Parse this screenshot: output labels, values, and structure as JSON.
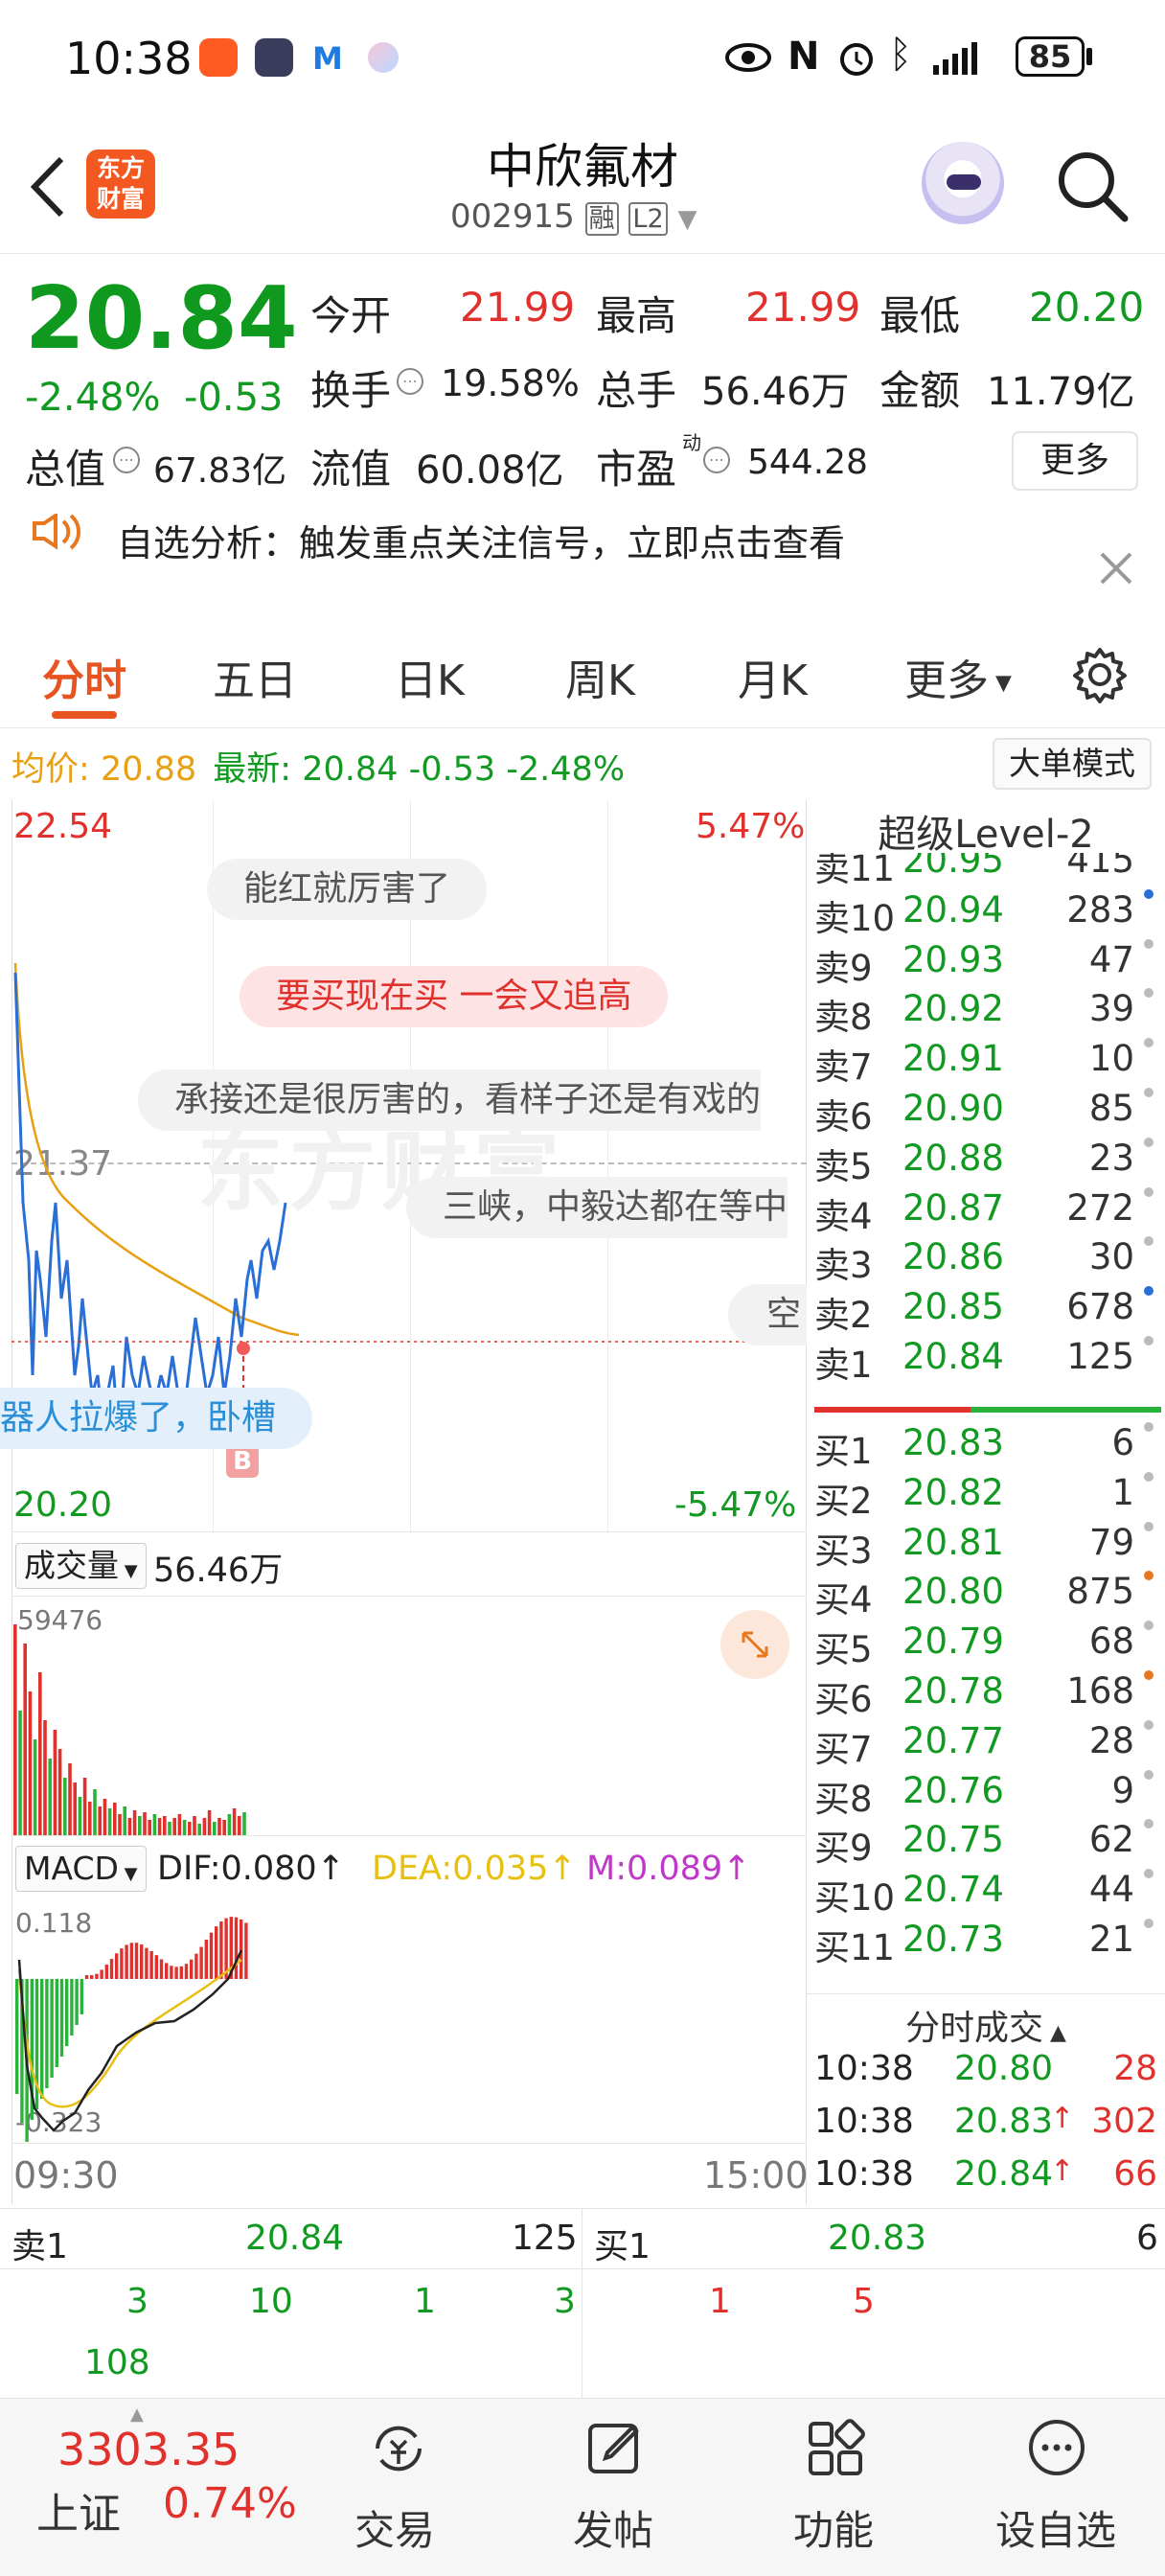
{
  "status_bar": {
    "time": "10:38",
    "battery": "85"
  },
  "header": {
    "logo_line1": "东方",
    "logo_line2": "财富",
    "stock_name": "中欣氟材",
    "code": "002915",
    "tag_margin": "融",
    "tag_level": "L2"
  },
  "quote": {
    "price": "20.84",
    "change_pct": "-2.48%",
    "change": "-0.53",
    "open_label": "今开",
    "open": "21.99",
    "high_label": "最高",
    "high": "21.99",
    "low_label": "最低",
    "low": "20.20",
    "turnover_label": "换手",
    "turnover": "19.58%",
    "volume_label": "总手",
    "volume": "56.46万",
    "amount_label": "金额",
    "amount": "11.79亿",
    "mktcap_label": "总值",
    "mktcap": "67.83亿",
    "float_label": "流值",
    "float": "60.08亿",
    "pe_label": "市盈",
    "pe_sup": "动",
    "pe": "544.28",
    "more": "更多"
  },
  "notice": {
    "text": "自选分析：触发重点关注信号，立即点击查看"
  },
  "tabs": [
    "分时",
    "五日",
    "日K",
    "周K",
    "月K",
    "更多"
  ],
  "info_line": {
    "avg_label": "均价:",
    "avg": "20.88",
    "latest_label": "最新:",
    "latest": "20.84",
    "chg": "-0.53",
    "pct": "-2.48%",
    "big_order_mode": "大单模式"
  },
  "chart": {
    "y_top": "22.54",
    "y_top_pct": "5.47%",
    "y_mid": "21.37",
    "y_bottom": "20.20",
    "y_bottom_pct": "-5.47%",
    "volume_label": "成交量",
    "volume_total": "56.46万",
    "volume_max": "59476",
    "macd_label": "MACD",
    "dif": "DIF:0.080↑",
    "dea": "DEA:0.035↑",
    "m": "M:0.089↑",
    "macd_max": "0.118",
    "macd_min": "-0.323",
    "time_start": "09:30",
    "time_end": "15:00",
    "buy_marker": "B"
  },
  "danmaku": [
    "能红就厉害了",
    "要买现在买  一会又追高",
    "承接还是很厉害的，看样子还是有戏的",
    "三峡，中毅达都在等中",
    "空",
    "器人拉爆了，卧槽"
  ],
  "level2": {
    "title": "超级Level-2",
    "asks": [
      {
        "label": "卖11",
        "price": "20.95",
        "vol": "415",
        "dot": "#2a6fd6"
      },
      {
        "label": "卖10",
        "price": "20.94",
        "vol": "283",
        "dot": "#2a6fd6"
      },
      {
        "label": "卖9",
        "price": "20.93",
        "vol": "47",
        "dot": "#bbbbbb"
      },
      {
        "label": "卖8",
        "price": "20.92",
        "vol": "39",
        "dot": "#bbbbbb"
      },
      {
        "label": "卖7",
        "price": "20.91",
        "vol": "10",
        "dot": "#bbbbbb"
      },
      {
        "label": "卖6",
        "price": "20.90",
        "vol": "85",
        "dot": "#bbbbbb"
      },
      {
        "label": "卖5",
        "price": "20.88",
        "vol": "23",
        "dot": "#bbbbbb"
      },
      {
        "label": "卖4",
        "price": "20.87",
        "vol": "272",
        "dot": "#bbbbbb"
      },
      {
        "label": "卖3",
        "price": "20.86",
        "vol": "30",
        "dot": "#bbbbbb"
      },
      {
        "label": "卖2",
        "price": "20.85",
        "vol": "678",
        "dot": "#2a6fd6"
      },
      {
        "label": "卖1",
        "price": "20.84",
        "vol": "125",
        "dot": "#bbbbbb"
      }
    ],
    "bids": [
      {
        "label": "买1",
        "price": "20.83",
        "vol": "6",
        "dot": "#bbbbbb"
      },
      {
        "label": "买2",
        "price": "20.82",
        "vol": "1",
        "dot": "#bbbbbb"
      },
      {
        "label": "买3",
        "price": "20.81",
        "vol": "79",
        "dot": "#bbbbbb"
      },
      {
        "label": "买4",
        "price": "20.80",
        "vol": "875",
        "dot": "#e8771e"
      },
      {
        "label": "买5",
        "price": "20.79",
        "vol": "68",
        "dot": "#bbbbbb"
      },
      {
        "label": "买6",
        "price": "20.78",
        "vol": "168",
        "dot": "#e8771e"
      },
      {
        "label": "买7",
        "price": "20.77",
        "vol": "28",
        "dot": "#bbbbbb"
      },
      {
        "label": "买8",
        "price": "20.76",
        "vol": "9",
        "dot": "#bbbbbb"
      },
      {
        "label": "买9",
        "price": "20.75",
        "vol": "62",
        "dot": "#bbbbbb"
      },
      {
        "label": "买10",
        "price": "20.74",
        "vol": "44",
        "dot": "#bbbbbb"
      },
      {
        "label": "买11",
        "price": "20.73",
        "vol": "21",
        "dot": "#bbbbbb"
      }
    ],
    "ticks_title": "分时成交",
    "ticks": [
      {
        "time": "10:38",
        "price": "20.80",
        "arrow": "",
        "vol": "28",
        "color": "#e0312d"
      },
      {
        "time": "10:38",
        "price": "20.83",
        "arrow": "↑",
        "vol": "302",
        "color": "#e0312d"
      },
      {
        "time": "10:38",
        "price": "20.84",
        "arrow": "↑",
        "vol": "66",
        "color": "#e0312d"
      }
    ]
  },
  "queue": {
    "sell_label": "卖1",
    "sell_price": "20.84",
    "sell_vol": "125",
    "buy_label": "买1",
    "buy_price": "20.83",
    "buy_vol": "6",
    "sell_orders": [
      "3",
      "10",
      "1",
      "3",
      "108"
    ],
    "buy_orders": [
      "1",
      "5"
    ]
  },
  "bottom_nav": {
    "index_value": "3303.35",
    "index_name": "上证",
    "index_pct": "0.74%",
    "items": [
      {
        "label": "交易",
        "icon": "trade-icon"
      },
      {
        "label": "发帖",
        "icon": "post-icon"
      },
      {
        "label": "功能",
        "icon": "function-icon"
      },
      {
        "label": "设自选",
        "icon": "watchlist-icon"
      }
    ]
  }
}
